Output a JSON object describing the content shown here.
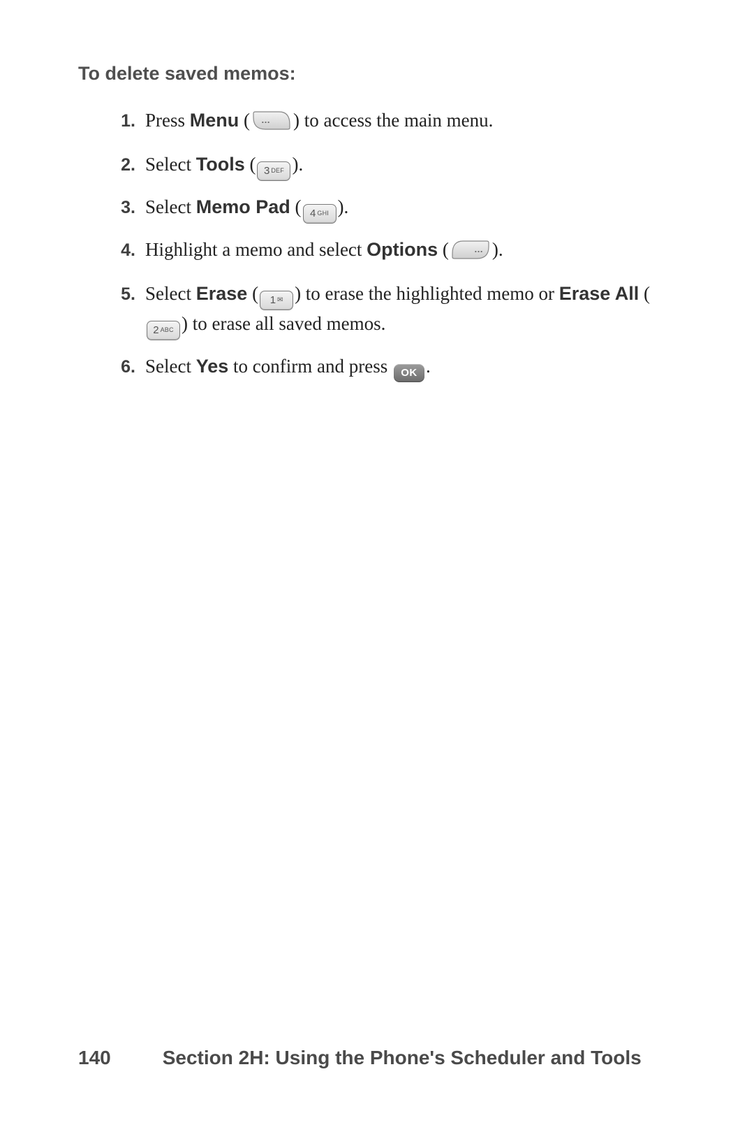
{
  "heading": "To delete saved memos:",
  "steps": {
    "s1": {
      "num": "1.",
      "pre": "Press ",
      "label": "Menu",
      "post1": " (",
      "post2": ") to access the main menu."
    },
    "s2": {
      "num": "2.",
      "pre": "Select ",
      "label": "Tools",
      "post1": " (",
      "post2": ")."
    },
    "s3": {
      "num": "3.",
      "pre": "Select ",
      "label": "Memo Pad",
      "post1": " (",
      "post2": ")."
    },
    "s4": {
      "num": "4.",
      "pre": "Highlight a memo and select ",
      "label": "Options",
      "post1": " (",
      "post2": ")."
    },
    "s5": {
      "num": "5.",
      "pre": "Select ",
      "label1": "Erase",
      "mid1": " (",
      "mid2": ") to erase the highlighted memo or ",
      "label2": "Erase All",
      "mid3": " (",
      "mid4": ") to erase all saved memos."
    },
    "s6": {
      "num": "6.",
      "pre": "Select ",
      "label": "Yes",
      "mid": " to confirm and press ",
      "post": "."
    }
  },
  "keys": {
    "k3": {
      "digit": "3",
      "letters": "DEF"
    },
    "k4": {
      "digit": "4",
      "letters": "GHI"
    },
    "k1": {
      "digit": "1",
      "envelope": "✉"
    },
    "k2": {
      "digit": "2",
      "letters": "ABC"
    },
    "ok": "OK"
  },
  "footer": {
    "page": "140",
    "section": "Section 2H: Using the Phone's Scheduler and Tools"
  }
}
